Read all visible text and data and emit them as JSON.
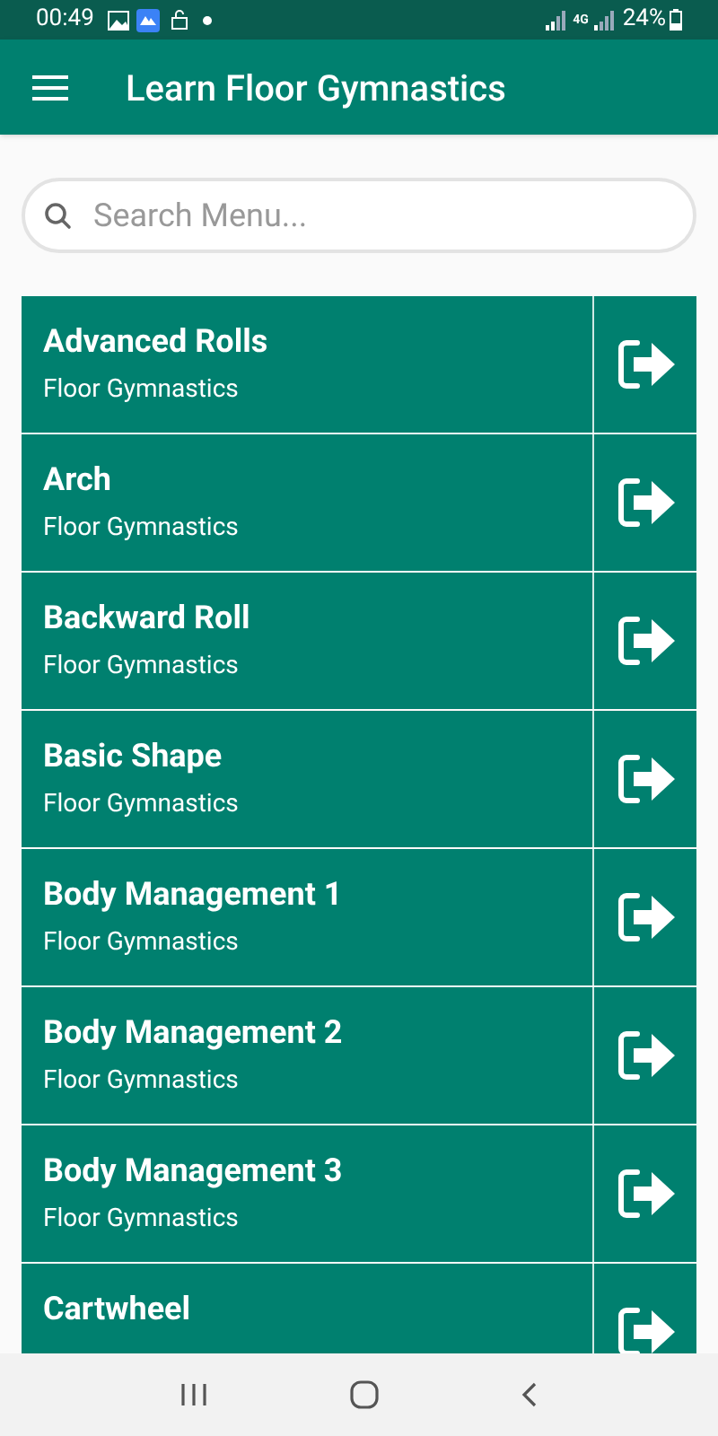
{
  "status_bar": {
    "time": "00:49",
    "network": "4G",
    "battery": "24%"
  },
  "app_bar": {
    "title": "Learn Floor Gymnastics"
  },
  "search": {
    "placeholder": "Search Menu..."
  },
  "items": [
    {
      "title": "Advanced Rolls",
      "subtitle": "Floor Gymnastics"
    },
    {
      "title": "Arch",
      "subtitle": "Floor Gymnastics"
    },
    {
      "title": "Backward Roll",
      "subtitle": "Floor Gymnastics"
    },
    {
      "title": "Basic Shape",
      "subtitle": "Floor Gymnastics"
    },
    {
      "title": "Body Management 1",
      "subtitle": "Floor Gymnastics"
    },
    {
      "title": "Body Management 2",
      "subtitle": "Floor Gymnastics"
    },
    {
      "title": "Body Management 3",
      "subtitle": "Floor Gymnastics"
    },
    {
      "title": "Cartwheel"
    }
  ]
}
